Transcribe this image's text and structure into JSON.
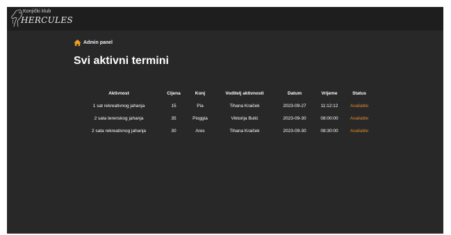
{
  "navbar": {
    "logo": {
      "top_text": "Konjički klub",
      "main_text": "HERCULES",
      "icon": "horse-logo"
    }
  },
  "breadcrumb": {
    "icon": "home-icon",
    "label": "Admin panel"
  },
  "page_title": "Svi aktivni termini",
  "table": {
    "headers": {
      "activity": "Aktivnost",
      "price": "Cijena",
      "horse": "Konj",
      "leader": "Voditelj aktivnosti",
      "date": "Datum",
      "time": "Vrijeme",
      "status": "Status"
    },
    "rows": [
      {
        "activity": "1 sat rekreativnog jahanja",
        "price": "15",
        "horse": "Pia",
        "leader": "Tihana Kraiček",
        "date": "2023-09-27",
        "time": "11:12:12",
        "status": "Available"
      },
      {
        "activity": "2 sata terenskog jahanja",
        "price": "35",
        "horse": "Pioggia",
        "leader": "Viktorija Bulić",
        "date": "2023-09-30",
        "time": "08:00:00",
        "status": "Available"
      },
      {
        "activity": "2 sata rekreativnog jahanja",
        "price": "30",
        "horse": "Ares",
        "leader": "Tihana Kraiček",
        "date": "2023-09-30",
        "time": "08:30:00",
        "status": "Available"
      }
    ]
  },
  "colors": {
    "background": "#282828",
    "navbar": "#1e1e1e",
    "status_available": "#e08a2c",
    "home_icon": "#f0a020"
  }
}
